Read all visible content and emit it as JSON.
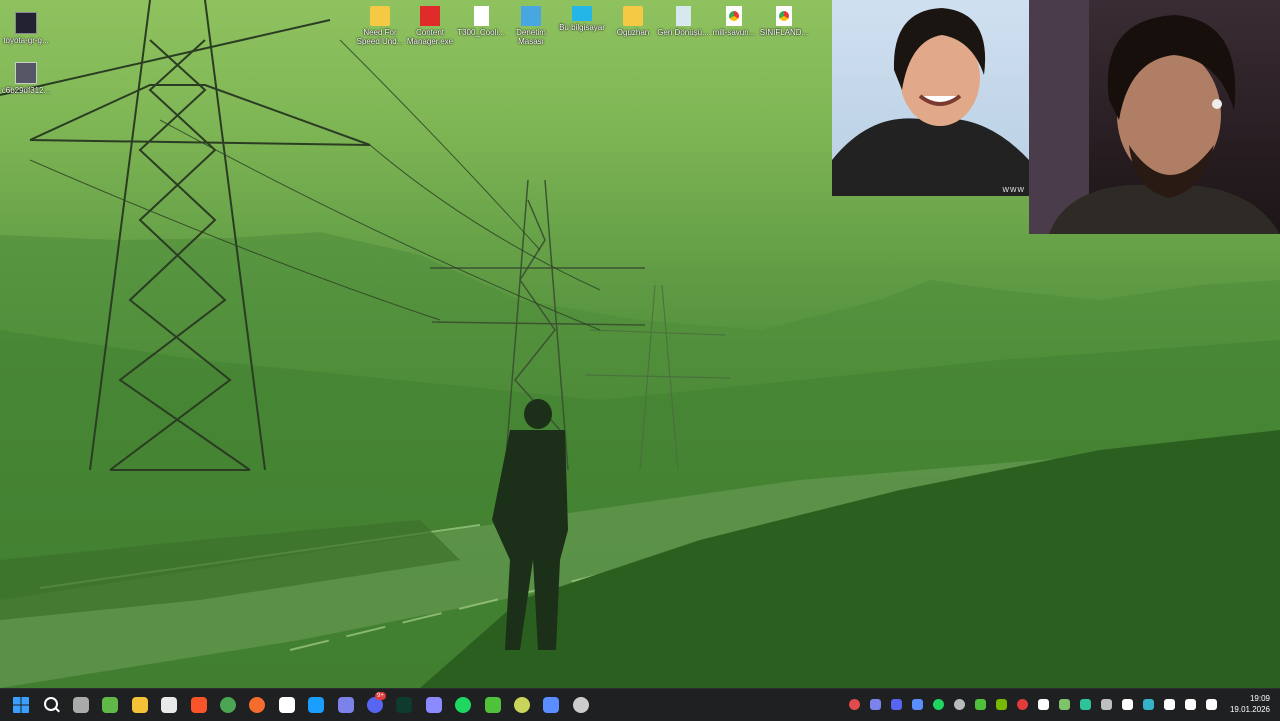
{
  "desktop_icons": [
    {
      "label": "toyota-gr-g...",
      "icon": "image-file-icon"
    },
    {
      "label": "c6b29df312...",
      "icon": "image-file-icon"
    },
    {
      "label": "Need For Speed Und...",
      "icon": "folder-icon"
    },
    {
      "label": "Content Manager.exe",
      "icon": "content-manager-icon"
    },
    {
      "label": "T300_Cooli...",
      "icon": "document-icon"
    },
    {
      "label": "Denetim Masası",
      "icon": "control-panel-icon"
    },
    {
      "label": "Bu bilgisayar",
      "icon": "computer-icon"
    },
    {
      "label": "Oguzhan",
      "icon": "folder-icon"
    },
    {
      "label": "Geri Dönüşü...",
      "icon": "recycle-bin-icon"
    },
    {
      "label": "mill-savun...",
      "icon": "chrome-shortcut-icon"
    },
    {
      "label": "SINIFLAND...",
      "icon": "chrome-shortcut-icon"
    }
  ],
  "overlay": {
    "watermark": "www"
  },
  "taskbar": {
    "apps": [
      {
        "name": "start-button",
        "color": "#3aa0ff"
      },
      {
        "name": "search-button",
        "color": "#ffffff"
      },
      {
        "name": "app-clock-icon",
        "color": "#aaaaaa"
      },
      {
        "name": "xbox-icon",
        "color": "#5fb848"
      },
      {
        "name": "file-explorer-icon",
        "color": "#f3c237"
      },
      {
        "name": "store-icon",
        "color": "#e9e9e9"
      },
      {
        "name": "brave-icon",
        "color": "#fb542b"
      },
      {
        "name": "chrome-icon",
        "color": "#4ba553"
      },
      {
        "name": "origin-icon",
        "color": "#f56c2d"
      },
      {
        "name": "epic-games-icon",
        "color": "#ffffff"
      },
      {
        "name": "steam-icon",
        "color": "#1b9fff"
      },
      {
        "name": "teams-icon",
        "color": "#7b83eb"
      },
      {
        "name": "discord-icon",
        "color": "#5865f2"
      },
      {
        "name": "terminal-icon",
        "color": "#0e3b2e"
      },
      {
        "name": "app-dots-icon",
        "color": "#8b8bff"
      },
      {
        "name": "spotify-icon",
        "color": "#1ed760"
      },
      {
        "name": "play-icon",
        "color": "#4fc13a"
      },
      {
        "name": "razer-icon",
        "color": "#c9d45a"
      },
      {
        "name": "app-blue-icon",
        "color": "#5a8dff"
      },
      {
        "name": "obs-icon",
        "color": "#cccccc"
      }
    ],
    "discord_badge": "9+",
    "tray_icons": [
      {
        "name": "tray-record-icon",
        "color": "#e14b4b"
      },
      {
        "name": "tray-teams-icon",
        "color": "#7b83eb"
      },
      {
        "name": "tray-discord-icon",
        "color": "#5865f2"
      },
      {
        "name": "tray-diamond-icon",
        "color": "#5a8dff"
      },
      {
        "name": "tray-spotify-icon",
        "color": "#1ed760"
      },
      {
        "name": "tray-settings-icon",
        "color": "#bbbbbb"
      },
      {
        "name": "tray-play-icon",
        "color": "#4fc13a"
      },
      {
        "name": "tray-nvidia-icon",
        "color": "#76b900"
      },
      {
        "name": "tray-vpn-icon",
        "color": "#e23b3b"
      },
      {
        "name": "tray-bug-icon",
        "color": "#ffffff"
      },
      {
        "name": "tray-battery-icon",
        "color": "#7ec26a"
      },
      {
        "name": "tray-edge-icon",
        "color": "#2fc39a"
      },
      {
        "name": "tray-steam-icon",
        "color": "#bfbfbf"
      },
      {
        "name": "tray-pen-icon",
        "color": "#ffffff"
      },
      {
        "name": "tray-shield-icon",
        "color": "#36b3c9"
      },
      {
        "name": "tray-mic-icon",
        "color": "#ffffff"
      },
      {
        "name": "tray-display-icon",
        "color": "#ffffff"
      },
      {
        "name": "tray-volume-icon",
        "color": "#ffffff"
      }
    ],
    "clock": {
      "time": "19:09",
      "date": "19.01.2026"
    }
  }
}
